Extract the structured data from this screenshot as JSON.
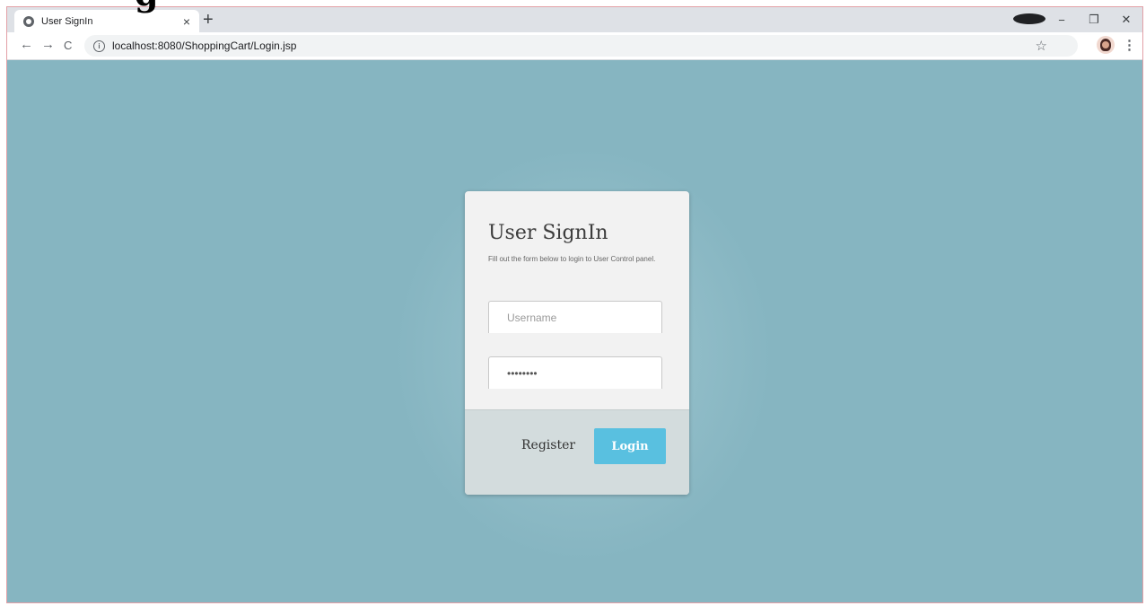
{
  "browser": {
    "tab_title": "User SignIn",
    "tab_close": "×",
    "new_tab": "+",
    "url": "localhost:8080/ShoppingCart/Login.jsp",
    "back": "←",
    "forward": "→",
    "reload": "C",
    "star": "☆",
    "menu": "⋮",
    "minimize": "−",
    "restore": "❐",
    "close": "✕"
  },
  "heading_fragment": "g",
  "card": {
    "title": "User SignIn",
    "subtitle": "Fill out the form below to login to User Control panel.",
    "username_placeholder": "Username",
    "password_value": "password",
    "register_label": "Register",
    "login_label": "Login"
  },
  "colors": {
    "background": "#86b5c1",
    "login_button": "#59c0e0",
    "card": "#f2f2f2",
    "footer": "#d3dcdd"
  }
}
